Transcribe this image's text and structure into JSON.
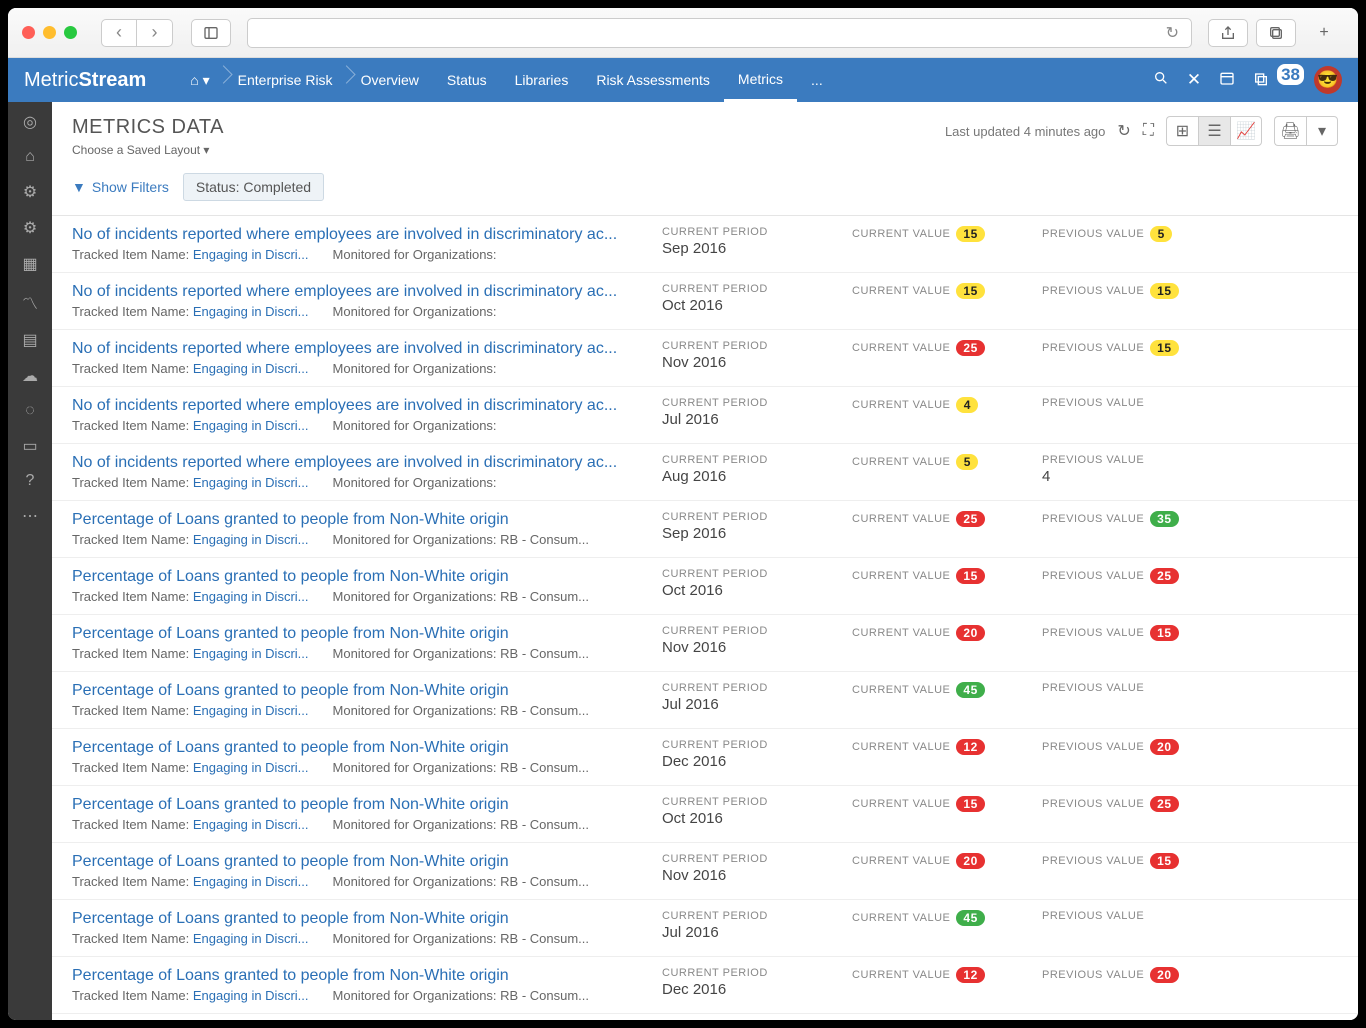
{
  "brand": {
    "a": "Metric",
    "b": "Stream"
  },
  "nav": [
    "Enterprise Risk",
    "Overview",
    "Status",
    "Libraries",
    "Risk Assessments",
    "Metrics",
    "..."
  ],
  "notif_badge": "38",
  "page_title": "METRICS DATA",
  "layout_label": "Choose a Saved Layout",
  "updated": "Last updated 4 minutes ago",
  "show_filters": "Show Filters",
  "filter_tag": "Status: Completed",
  "labels": {
    "period": "CURRENT PERIOD",
    "cur": "CURRENT VALUE",
    "prev": "PREVIOUS VALUE",
    "tracked": "Tracked Item Name:",
    "monitored": "Monitored for Organizations:",
    "tlink": "Engaging in Discri..."
  },
  "rows": [
    {
      "t": "No of incidents reported where employees are involved in discriminatory ac...",
      "org": "",
      "p": "Sep 2016",
      "cv": "15",
      "cc": "py",
      "pv": "5",
      "pc": "py"
    },
    {
      "t": "No of incidents reported where employees are involved in discriminatory ac...",
      "org": "",
      "p": "Oct 2016",
      "cv": "15",
      "cc": "py",
      "pv": "15",
      "pc": "py"
    },
    {
      "t": "No of incidents reported where employees are involved in discriminatory ac...",
      "org": "",
      "p": "Nov 2016",
      "cv": "25",
      "cc": "pr",
      "pv": "15",
      "pc": "py"
    },
    {
      "t": "No of incidents reported where employees are involved in discriminatory ac...",
      "org": "",
      "p": "Jul 2016",
      "cv": "4",
      "cc": "py",
      "pv": "",
      "pc": ""
    },
    {
      "t": "No of incidents reported where employees are involved in discriminatory ac...",
      "org": "",
      "p": "Aug 2016",
      "cv": "5",
      "cc": "py",
      "pv": "4",
      "pc": ""
    },
    {
      "t": "Percentage of Loans granted to people from Non-White origin",
      "org": "RB - Consum...",
      "p": "Sep 2016",
      "cv": "25",
      "cc": "pr",
      "pv": "35",
      "pc": "pg"
    },
    {
      "t": "Percentage of Loans granted to people from Non-White origin",
      "org": "RB - Consum...",
      "p": "Oct 2016",
      "cv": "15",
      "cc": "pr",
      "pv": "25",
      "pc": "pr"
    },
    {
      "t": "Percentage of Loans granted to people from Non-White origin",
      "org": "RB - Consum...",
      "p": "Nov 2016",
      "cv": "20",
      "cc": "pr",
      "pv": "15",
      "pc": "pr"
    },
    {
      "t": "Percentage of Loans granted to people from Non-White origin",
      "org": "RB - Consum...",
      "p": "Jul 2016",
      "cv": "45",
      "cc": "pg",
      "pv": "",
      "pc": ""
    },
    {
      "t": "Percentage of Loans granted to people from Non-White origin",
      "org": "RB - Consum...",
      "p": "Dec 2016",
      "cv": "12",
      "cc": "pr",
      "pv": "20",
      "pc": "pr"
    },
    {
      "t": "Percentage of Loans granted to people from Non-White origin",
      "org": "RB - Consum...",
      "p": "Oct 2016",
      "cv": "15",
      "cc": "pr",
      "pv": "25",
      "pc": "pr"
    },
    {
      "t": "Percentage of Loans granted to people from Non-White origin",
      "org": "RB - Consum...",
      "p": "Nov 2016",
      "cv": "20",
      "cc": "pr",
      "pv": "15",
      "pc": "pr"
    },
    {
      "t": "Percentage of Loans granted to people from Non-White origin",
      "org": "RB - Consum...",
      "p": "Jul 2016",
      "cv": "45",
      "cc": "pg",
      "pv": "",
      "pc": ""
    },
    {
      "t": "Percentage of Loans granted to people from Non-White origin",
      "org": "RB - Consum...",
      "p": "Dec 2016",
      "cv": "12",
      "cc": "pr",
      "pv": "20",
      "pc": "pr"
    }
  ]
}
